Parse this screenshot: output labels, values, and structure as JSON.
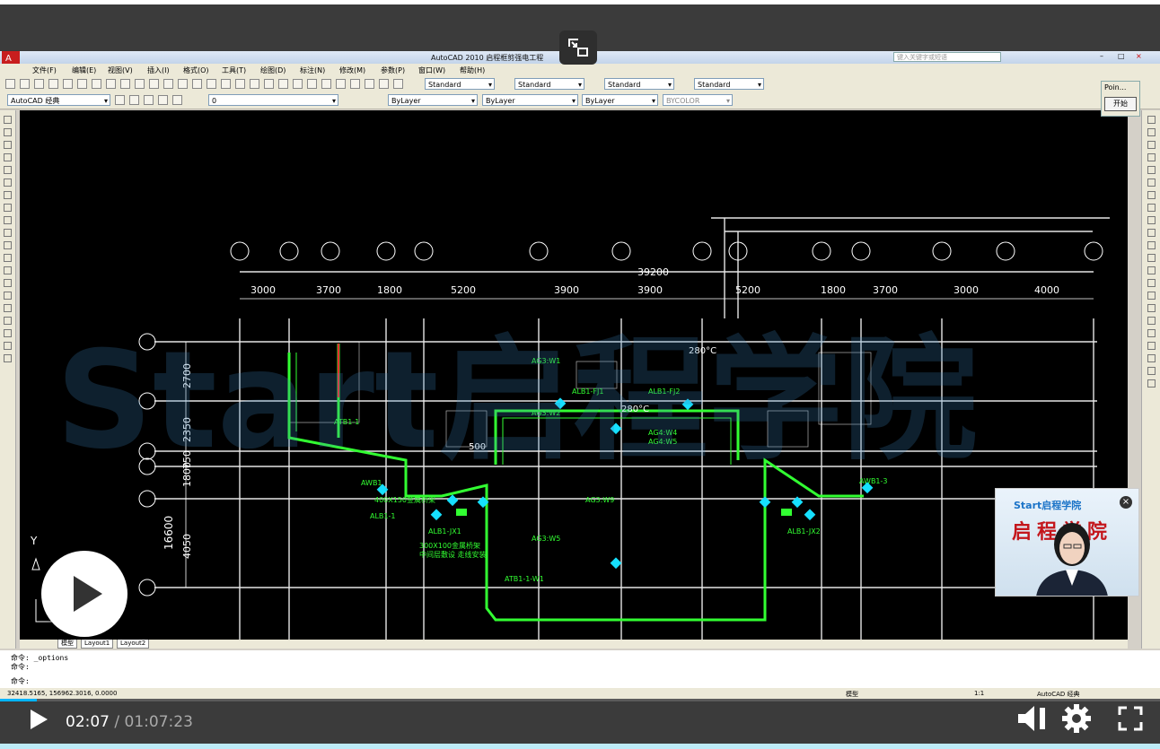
{
  "window": {
    "title": "AutoCAD 2010  启程框剪强电工程",
    "search_placeholder": "键入关键字或短语"
  },
  "menu": [
    "文件(F)",
    "编辑(E)",
    "视图(V)",
    "插入(I)",
    "格式(O)",
    "工具(T)",
    "绘图(D)",
    "标注(N)",
    "修改(M)",
    "参数(P)",
    "窗口(W)",
    "帮助(H)"
  ],
  "toolbar": {
    "styles": [
      "Standard",
      "Standard",
      "Standard",
      "Standard"
    ],
    "workspace": "AutoCAD 经典",
    "layer": "0",
    "color": "ByLayer",
    "linetype": "ByLayer",
    "lineweight": "ByLayer",
    "plotstyle": "BYCOLOR"
  },
  "drawing": {
    "top_dimension": "39200",
    "dimensions": [
      "3000",
      "3700",
      "1800",
      "5200",
      "3900",
      "3900",
      "5200",
      "1800",
      "3700",
      "3000",
      "4000"
    ],
    "vertical_dimensions": [
      "2700",
      "2350",
      "750",
      "1800",
      "4050"
    ],
    "total_vertical": "16600",
    "labels": [
      "280°C",
      "280°C",
      "AWB1",
      "ALB1-1",
      "ALB1-JX1",
      "ALB1-JX2",
      "ALB1-FJ1",
      "ALB1-FJ2",
      "AWB1-3",
      "ATB1-1",
      "ATB1-1-W1",
      "AG3:W1",
      "AG3:W2",
      "AG3:W9",
      "AG3:W5",
      "AG4:W4",
      "AG4:W5",
      "500",
      "400X150金属桥架",
      "300X100金属桥架",
      "中间层敷设 走线安装"
    ],
    "axis_y": "Y"
  },
  "layout_tabs": [
    "模型",
    "Layout1",
    "Layout2"
  ],
  "command_lines": [
    "命令: _options",
    "命令:",
    "命令:"
  ],
  "status": {
    "coords": "32418.5165, 156962.3016, 0.0000",
    "model": "模型",
    "annotation_scale": "1:1",
    "workspace": "AutoCAD 经典"
  },
  "point_panel": {
    "title": "Poin...",
    "start": "开始"
  },
  "webcam": {
    "brand": "Start启程学院",
    "text": "启程学院"
  },
  "watermark": "Start启程学院",
  "player": {
    "current": "02:07",
    "duration": "01:07:23",
    "progress_fraction": 0.0314
  },
  "colors": {
    "cad_bg": "#000000",
    "accent": "#00b4ff",
    "cable": "#32ff32",
    "equipment": "#16e0ff"
  }
}
